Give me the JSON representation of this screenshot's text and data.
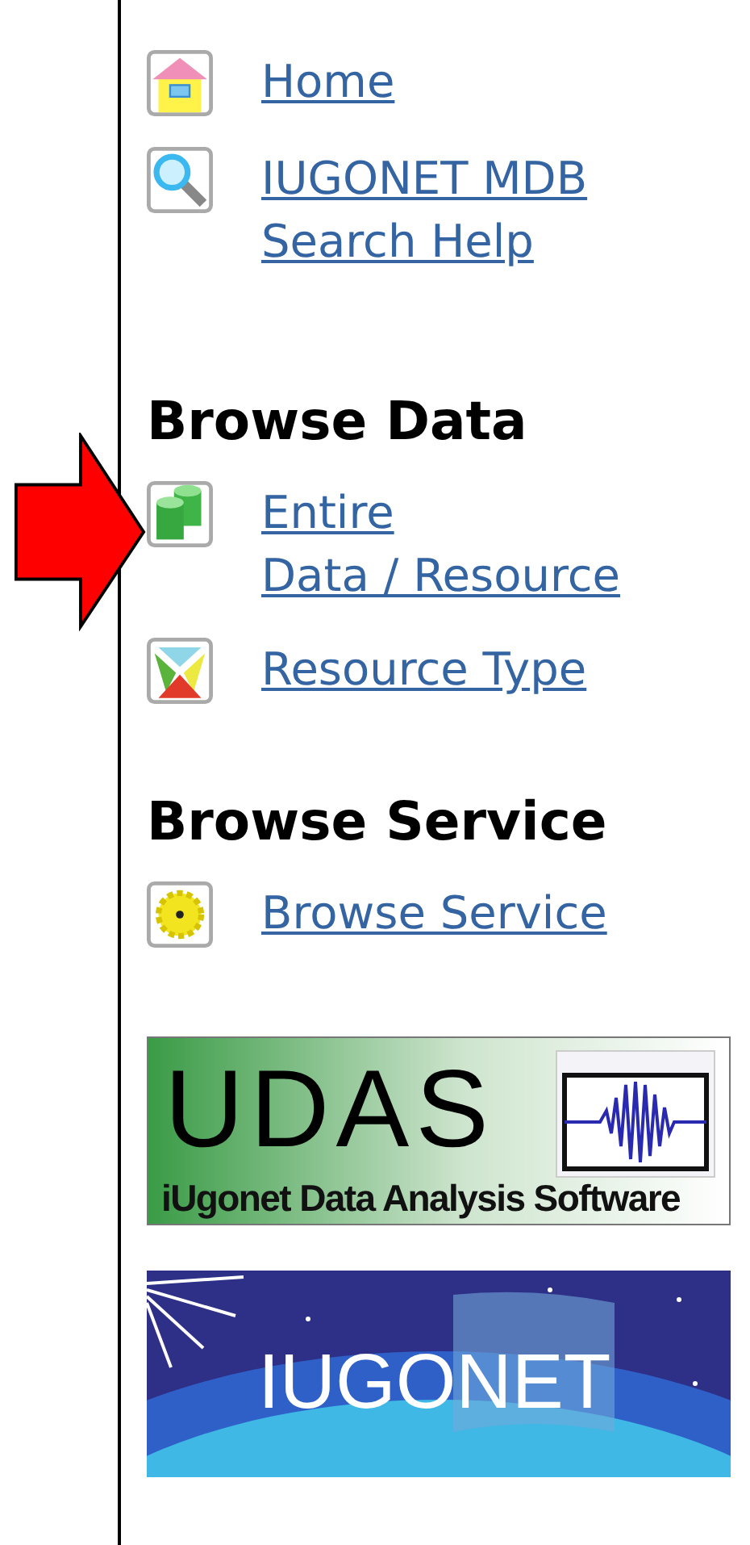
{
  "top_links": [
    {
      "kind": "home",
      "lines": [
        "Home"
      ],
      "pointer": false
    },
    {
      "kind": "search",
      "lines": [
        "IUGONET MDB",
        "Search Help"
      ],
      "pointer": false
    }
  ],
  "sections": [
    {
      "heading": "Browse Data",
      "links": [
        {
          "kind": "database",
          "lines": [
            "Entire",
            "Data / Resource"
          ],
          "pointer": true
        },
        {
          "kind": "triangles",
          "lines": [
            "Resource Type"
          ],
          "pointer": false
        }
      ]
    },
    {
      "heading": "Browse Service",
      "links": [
        {
          "kind": "gear",
          "lines": [
            "Browse Service"
          ],
          "pointer": false
        }
      ]
    }
  ],
  "banners": [
    {
      "kind": "udas",
      "title": "UDAS",
      "caption": "iUgonet Data Analysis Software"
    },
    {
      "kind": "iugonet",
      "title": "IUGONET"
    }
  ]
}
